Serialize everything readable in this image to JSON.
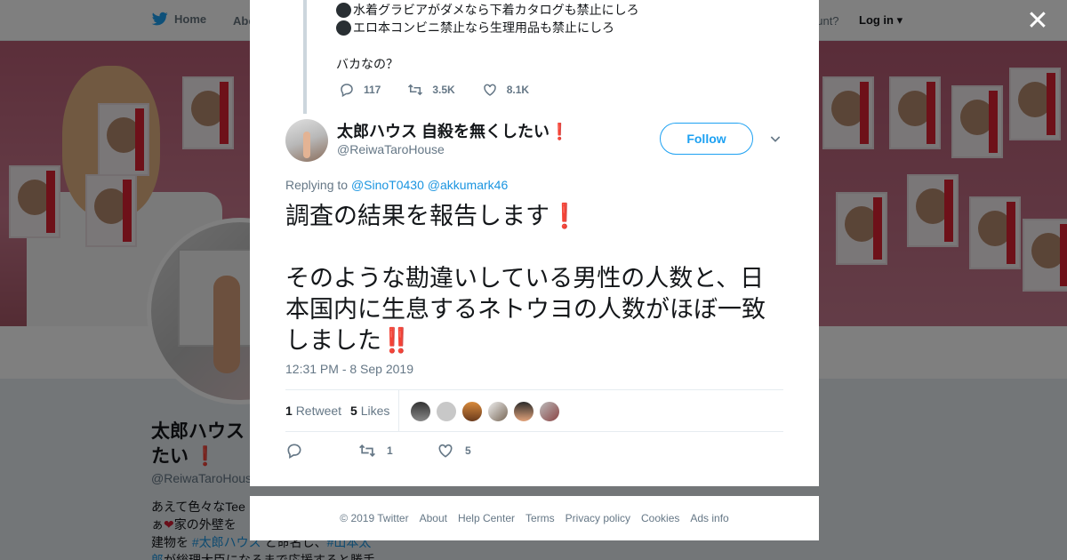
{
  "nav": {
    "home_label": "Home",
    "about_label": "Abo",
    "account_prompt": "ccount?",
    "login_label": "Log in"
  },
  "profile": {
    "name_line1": "太郎ハウス",
    "name_line2": "たい",
    "handle": "@ReiwaTaroHouse",
    "bio_line1": "あえて色々なTee",
    "bio_line2": "家の外壁を",
    "bio_line3_pre": "建物を",
    "bio_tag1": "#太郎ハウス",
    "bio_line3_mid": "と命名し、",
    "bio_tag2": "#山本太",
    "bio_line4_tag": "郎",
    "bio_line4_rest": "が総理大臣になるまで応援すると勝手"
  },
  "previous_tweet": {
    "line1": "水着グラビアがダメなら下着カタログも禁止にしろ",
    "line2": "エロ本コンビニ禁止なら生理用品も禁止にしろ",
    "line3": "バカなの？",
    "replies": "117",
    "retweets": "3.5K",
    "likes": "8.1K"
  },
  "tweet": {
    "author_name": "太郎ハウス 自殺を無くしたい",
    "author_name_emoji": "❗",
    "author_handle": "@ReiwaTaroHouse",
    "follow_label": "Follow",
    "replying_prefix": "Replying to",
    "reply_to_1": "@SinoT0430",
    "reply_to_2": "@akkumark46",
    "text_line1": "調査の結果を報告します",
    "text_line1_emoji": "❗",
    "text_para2": "そのような勘違いしている男性の人数と、日本国内に生息するネトウヨの人数がほぼ一致しました",
    "text_para2_emoji": "‼️",
    "timestamp": "12:31 PM - 8 Sep 2019",
    "retweet_count": "1",
    "retweet_label": "Retweet",
    "like_count": "5",
    "like_label": "Likes",
    "action_retweets": "1",
    "action_likes": "5"
  },
  "footer": {
    "copyright": "© 2019 Twitter",
    "about": "About",
    "help": "Help Center",
    "terms": "Terms",
    "privacy": "Privacy policy",
    "cookies": "Cookies",
    "ads": "Ads info"
  },
  "icons": {
    "close": "close-icon",
    "chevron": "chevron-down-icon",
    "reply": "reply-icon",
    "retweet": "retweet-icon",
    "like": "heart-icon",
    "brand": "twitter-bird-icon"
  },
  "colors": {
    "accent": "#1da1f2",
    "link": "#1b95e0",
    "emoji_red": "#d21d34"
  }
}
